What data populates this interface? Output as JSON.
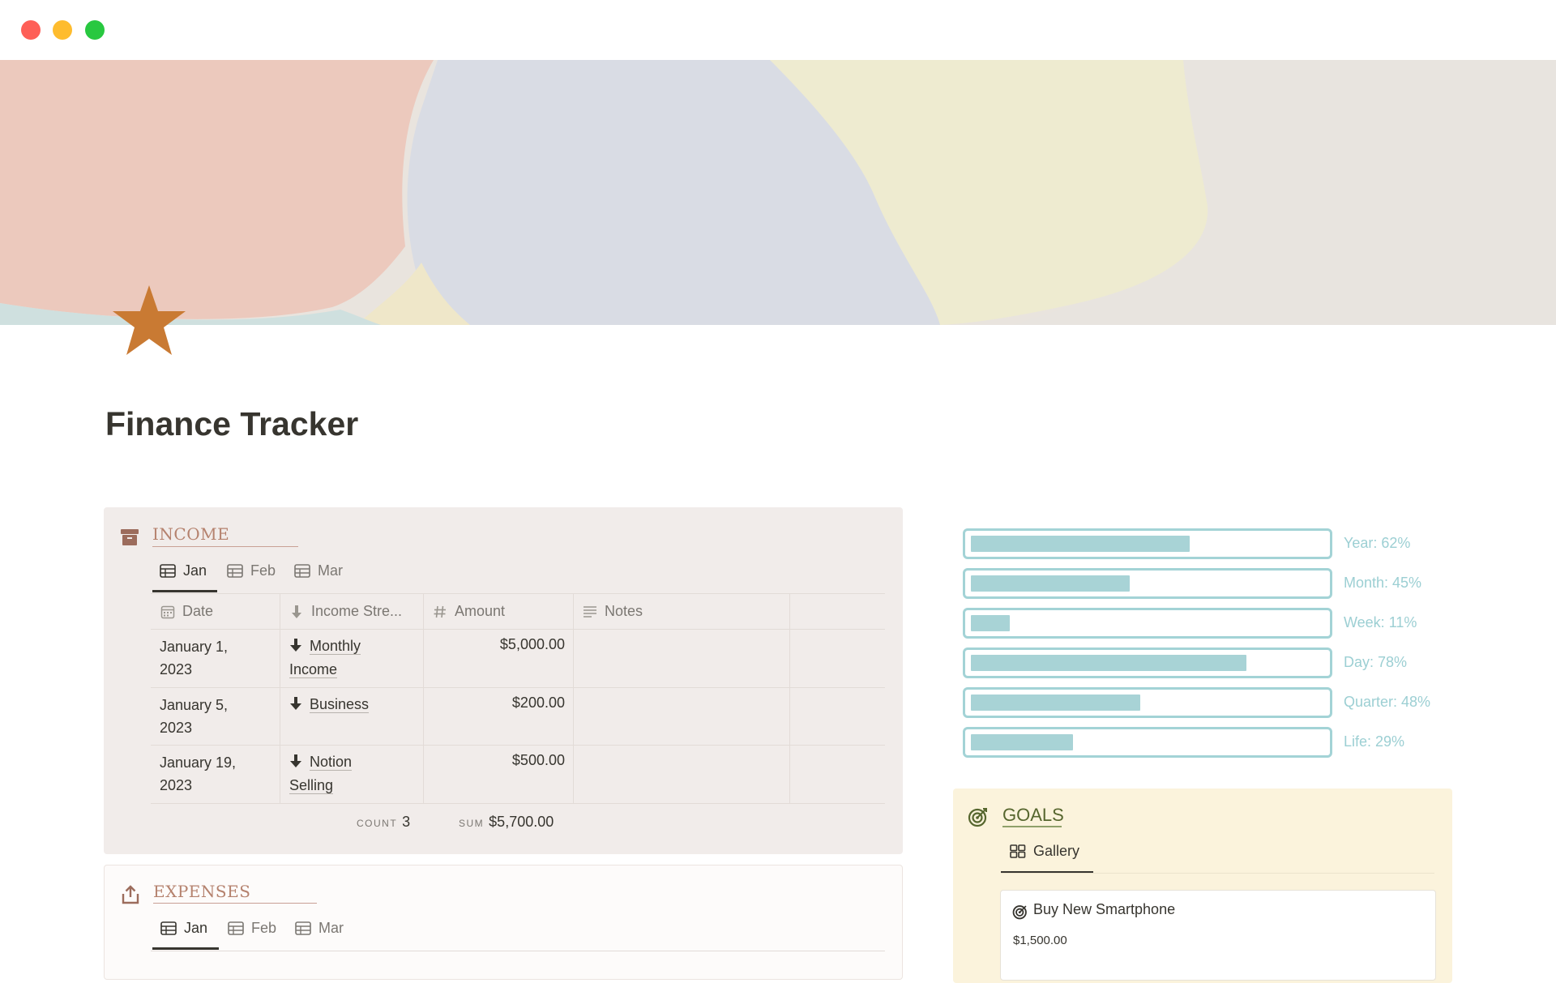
{
  "window": {
    "controls": [
      "close",
      "minimize",
      "maximize"
    ]
  },
  "page": {
    "title": "Finance Tracker",
    "icon": "star-icon",
    "icon_color": "#c97a33"
  },
  "income": {
    "title": "INCOME",
    "icon": "archive-box-icon",
    "tabs": [
      {
        "label": "Jan",
        "active": true
      },
      {
        "label": "Feb",
        "active": false
      },
      {
        "label": "Mar",
        "active": false
      }
    ],
    "columns": [
      {
        "label": "Date",
        "icon": "calendar-icon"
      },
      {
        "label": "Income Stre...",
        "icon": "arrow-down-icon"
      },
      {
        "label": "Amount",
        "icon": "hash-icon"
      },
      {
        "label": "Notes",
        "icon": "text-lines-icon"
      }
    ],
    "rows": [
      {
        "date_line1": "January 1,",
        "date_line2": "2023",
        "stream_line1": "Monthly",
        "stream_line2": "Income",
        "amount": "$5,000.00",
        "notes": ""
      },
      {
        "date_line1": "January 5,",
        "date_line2": "2023",
        "stream_line1": "Business",
        "stream_line2": "",
        "amount": "$200.00",
        "notes": ""
      },
      {
        "date_line1": "January 19,",
        "date_line2": "2023",
        "stream_line1": "Notion",
        "stream_line2": "Selling",
        "amount": "$500.00",
        "notes": ""
      }
    ],
    "count_label": "COUNT",
    "count_value": "3",
    "sum_label": "SUM",
    "sum_value": "$5,700.00"
  },
  "expenses": {
    "title": "EXPENSES",
    "icon": "share-upload-icon",
    "tabs": [
      {
        "label": "Jan",
        "active": true
      },
      {
        "label": "Feb",
        "active": false
      },
      {
        "label": "Mar",
        "active": false
      }
    ]
  },
  "progress": [
    {
      "label": "Year: 62%",
      "fraction": 0.62
    },
    {
      "label": "Month: 45%",
      "fraction": 0.45
    },
    {
      "label": "Week: 11%",
      "fraction": 0.11
    },
    {
      "label": "Day: 78%",
      "fraction": 0.78
    },
    {
      "label": "Quarter: 48%",
      "fraction": 0.48
    },
    {
      "label": "Life: 29%",
      "fraction": 0.29
    }
  ],
  "goals": {
    "title": "GOALS",
    "icon": "target-icon",
    "view_tab": "Gallery",
    "cards": [
      {
        "title": "Buy New Smartphone",
        "price": "$1,500.00",
        "icon": "target-icon"
      }
    ]
  },
  "colors": {
    "income_bg": "#f1ecea",
    "goals_bg": "#fbf3dc",
    "progress": "#a8d3d6",
    "section_title": "#b5826e"
  }
}
